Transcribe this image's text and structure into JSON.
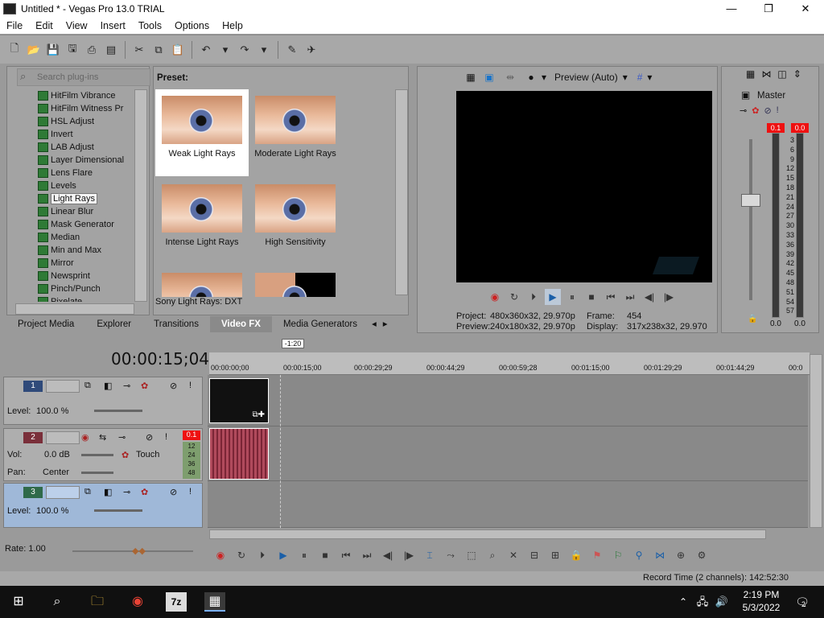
{
  "window": {
    "title": "Untitled * - Vegas Pro 13.0 TRIAL",
    "controls": [
      "—",
      "❐",
      "✕"
    ]
  },
  "menu": [
    "File",
    "Edit",
    "View",
    "Insert",
    "Tools",
    "Options",
    "Help"
  ],
  "toolbar_icons": [
    "new-icon",
    "open-icon",
    "save-icon",
    "save-as-icon",
    "render-icon",
    "properties-icon",
    "cut-icon",
    "copy-icon",
    "paste-icon",
    "undo-icon",
    "redo-icon",
    "explore-icon",
    "help-icon"
  ],
  "plugins": {
    "search_placeholder": "Search plug-ins",
    "items": [
      "HitFilm Vibrance",
      "HitFilm Witness Pr",
      "HSL Adjust",
      "Invert",
      "LAB Adjust",
      "Layer Dimensional",
      "Lens Flare",
      "Levels",
      "Light Rays",
      "Linear Blur",
      "Mask Generator",
      "Median",
      "Min and Max",
      "Mirror",
      "Newsprint",
      "Pinch/Punch",
      "Pixelate"
    ],
    "selected": "Light Rays"
  },
  "presets": {
    "label": "Preset:",
    "items": [
      "Weak Light Rays",
      "Moderate Light Rays",
      "Intense Light Rays",
      "High Sensitivity",
      "",
      ""
    ],
    "footer": "Sony Light Rays: DXT"
  },
  "tabs": [
    "Project Media",
    "Explorer",
    "Transitions",
    "Video FX",
    "Media Generators"
  ],
  "active_tab": "Video FX",
  "preview": {
    "mode": "Preview (Auto)",
    "project_label": "Project:",
    "project_value": "480x360x32, 29.970p",
    "preview_label": "Preview:",
    "preview_value": "240x180x32, 29.970p",
    "frame_label": "Frame:",
    "frame_value": "454",
    "display_label": "Display:",
    "display_value": "317x238x32, 29.970"
  },
  "master": {
    "label": "Master",
    "peak_left": "0.1",
    "peak_right": "0.0",
    "scale": [
      "3",
      "6",
      "9",
      "12",
      "15",
      "18",
      "21",
      "24",
      "27",
      "30",
      "33",
      "36",
      "39",
      "42",
      "45",
      "48",
      "51",
      "54",
      "57"
    ],
    "level_left": "0.0",
    "level_right": "0.0"
  },
  "timeline": {
    "timecode": "00:00:15;04",
    "marker": "-1:20",
    "ruler": [
      "00:00:00;00",
      "00:00:15;00",
      "00:00:29;29",
      "00:00:44;29",
      "00:00:59;28",
      "00:01:15;00",
      "00:01:29;29",
      "00:01:44;29",
      "00:0"
    ]
  },
  "tracks": [
    {
      "num": "1",
      "type": "video",
      "level_label": "Level:",
      "level_value": "100.0 %"
    },
    {
      "num": "2",
      "type": "audio",
      "vol_label": "Vol:",
      "vol_value": "0.0 dB",
      "pan_label": "Pan:",
      "pan_value": "Center",
      "mode": "Touch",
      "peak": "0.1",
      "meter": [
        "12",
        "24",
        "36",
        "48"
      ]
    },
    {
      "num": "3",
      "type": "video",
      "level_label": "Level:",
      "level_value": "100.0 %"
    }
  ],
  "rate": "Rate: 1.00",
  "status": "Record Time (2 channels): 142:52:30",
  "clock": {
    "time": "2:19 PM",
    "date": "5/3/2022"
  },
  "notifications": "2"
}
